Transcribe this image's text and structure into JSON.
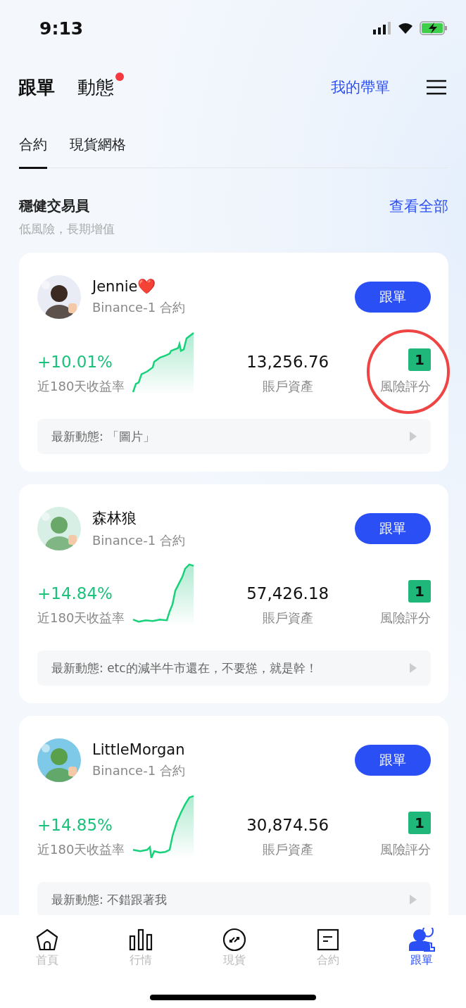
{
  "status_bar": {
    "time": "9:13"
  },
  "header": {
    "tabs": [
      {
        "label": "跟單",
        "selected": true,
        "badge": false
      },
      {
        "label": "動態",
        "selected": false,
        "badge": true
      }
    ],
    "my_link": "我的帶單"
  },
  "sub_tabs": [
    {
      "label": "合約",
      "selected": true
    },
    {
      "label": "現貨網格",
      "selected": false
    }
  ],
  "section": {
    "title": "穩健交易員",
    "subtitle": "低風險，長期增值",
    "view_all": "查看全部"
  },
  "traders": [
    {
      "name": "Jennie❤️",
      "account": "Binance-1 合約",
      "follow": "跟單",
      "return": "+10.01%",
      "return_label": "近180天收益率",
      "assets": "13,256.76",
      "assets_label": "賬戶資產",
      "risk": "1",
      "risk_label": "風險評分",
      "latest": "最新動態: 「圖片」",
      "highlighted": true
    },
    {
      "name": "森林狼",
      "account": "Binance-1 合約",
      "follow": "跟單",
      "return": "+14.84%",
      "return_label": "近180天收益率",
      "assets": "57,426.18",
      "assets_label": "賬戶資產",
      "risk": "1",
      "risk_label": "風險評分",
      "latest": "最新動態: etc的減半牛市還在，不要慫，就是幹！",
      "highlighted": false
    },
    {
      "name": "LittleMorgan",
      "account": "Binance-1 合約",
      "follow": "跟單",
      "return": "+14.85%",
      "return_label": "近180天收益率",
      "assets": "30,874.56",
      "assets_label": "賬戶資產",
      "risk": "1",
      "risk_label": "風險評分",
      "latest": "最新動態: 不錯跟著我",
      "highlighted": false
    }
  ],
  "nav": [
    {
      "label": "首頁",
      "selected": false
    },
    {
      "label": "行情",
      "selected": false
    },
    {
      "label": "現貨",
      "selected": false
    },
    {
      "label": "合約",
      "selected": false
    },
    {
      "label": "跟單",
      "selected": true
    }
  ]
}
